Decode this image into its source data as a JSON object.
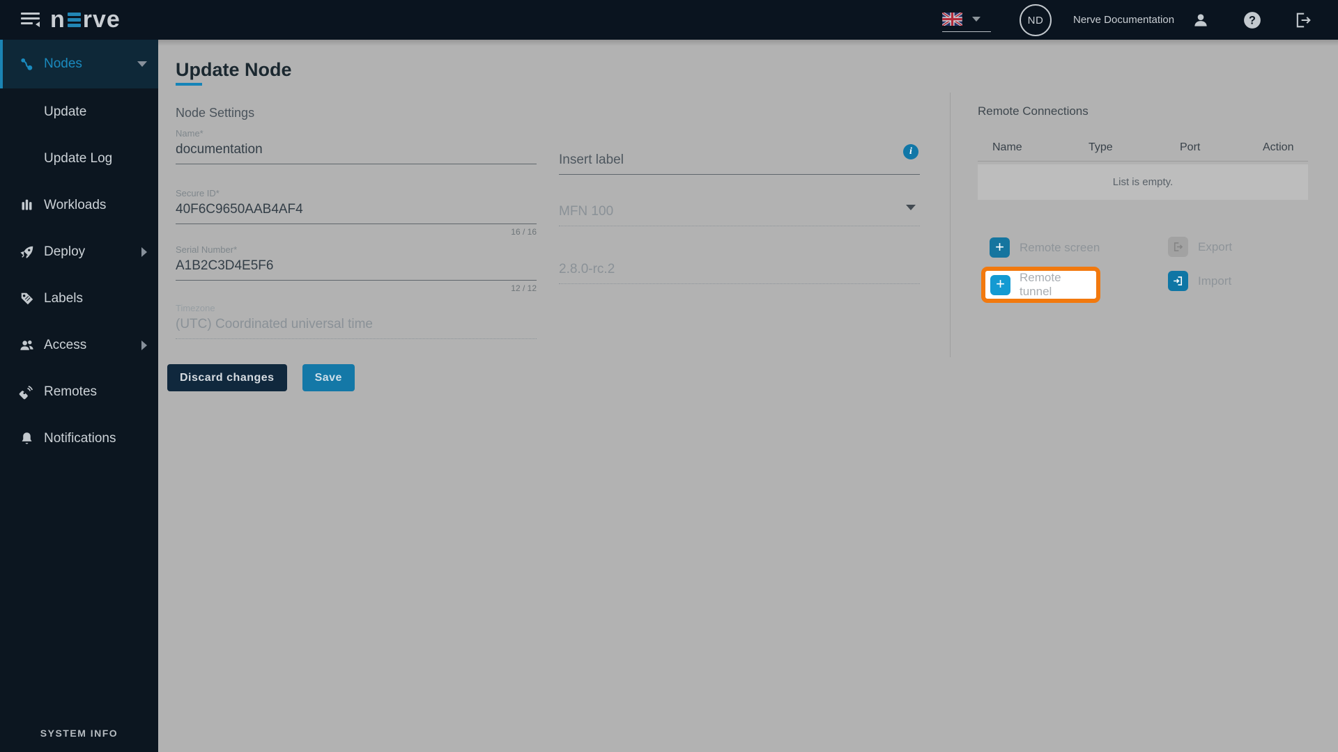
{
  "topbar": {
    "brand": "nerve",
    "brand_prefix": "n",
    "brand_suffix": "rve",
    "avatar_initials": "ND",
    "account_name": "Nerve Documentation"
  },
  "sidebar": {
    "items": {
      "nodes": "Nodes",
      "update": "Update",
      "update_log": "Update Log",
      "workloads": "Workloads",
      "deploy": "Deploy",
      "labels": "Labels",
      "access": "Access",
      "remotes": "Remotes",
      "notifications": "Notifications"
    },
    "system_info": "SYSTEM INFO"
  },
  "page": {
    "title": "Update Node",
    "section": "Node Settings"
  },
  "form": {
    "name": {
      "label": "Name*",
      "value": "documentation"
    },
    "secure_id": {
      "label": "Secure ID*",
      "value": "40F6C9650AAB4AF4",
      "counter": "16 / 16"
    },
    "serial": {
      "label": "Serial Number*",
      "value": "A1B2C3D4E5F6",
      "counter": "12 / 12"
    },
    "timezone": {
      "label": "Timezone",
      "value": "(UTC) Coordinated universal time"
    },
    "label_input": {
      "placeholder": "Insert label"
    },
    "model": {
      "value": "MFN 100"
    },
    "version": {
      "value": "2.8.0-rc.2"
    },
    "discard_label": "Discard changes",
    "save_label": "Save"
  },
  "remote_connections": {
    "title": "Remote Connections",
    "headers": [
      "Name",
      "Type",
      "Port",
      "Action"
    ],
    "empty": "List is empty.",
    "remote_screen_label": "Remote screen",
    "remote_tunnel_label": "Remote tunnel",
    "export_label": "Export",
    "import_label": "Import"
  },
  "colors": {
    "accent_blue": "#1584b8",
    "highlight_orange": "#f2790e",
    "save_blue": "#1478a7",
    "dark_navy": "#10283d"
  }
}
